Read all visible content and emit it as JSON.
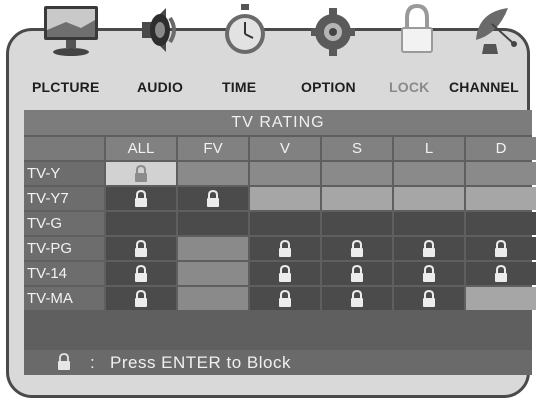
{
  "menu": {
    "items": [
      {
        "label": "PLCTURE",
        "icon": "monitor-icon"
      },
      {
        "label": "AUDIO",
        "icon": "speaker-icon"
      },
      {
        "label": "TIME",
        "icon": "stopwatch-icon"
      },
      {
        "label": "OPTION",
        "icon": "gear-icon"
      },
      {
        "label": "LOCK",
        "icon": "padlock-icon"
      },
      {
        "label": "CHANNEL",
        "icon": "satellite-dish-icon"
      }
    ],
    "active": "LOCK"
  },
  "rating_table": {
    "title": "TV RATING",
    "columns": [
      "ALL",
      "FV",
      "V",
      "S",
      "L",
      "D"
    ],
    "rows": [
      {
        "label": "TV-Y",
        "cells": [
          "locked-selected",
          "blank",
          "blank",
          "blank",
          "blank",
          "blank"
        ]
      },
      {
        "label": "TV-Y7",
        "cells": [
          "locked",
          "locked",
          "blank",
          "blank",
          "blank",
          "blank"
        ]
      },
      {
        "label": "TV-G",
        "cells": [
          "blank",
          "blank",
          "blank",
          "blank",
          "blank",
          "blank"
        ]
      },
      {
        "label": "TV-PG",
        "cells": [
          "locked",
          "blank",
          "locked",
          "locked",
          "locked",
          "locked"
        ]
      },
      {
        "label": "TV-14",
        "cells": [
          "locked",
          "blank",
          "locked",
          "locked",
          "locked",
          "locked"
        ]
      },
      {
        "label": "TV-MA",
        "cells": [
          "locked",
          "blank",
          "locked",
          "locked",
          "locked",
          "blank"
        ]
      }
    ]
  },
  "footer": {
    "icon": "padlock-icon",
    "separator": ":",
    "text": "Press ENTER to Block"
  }
}
